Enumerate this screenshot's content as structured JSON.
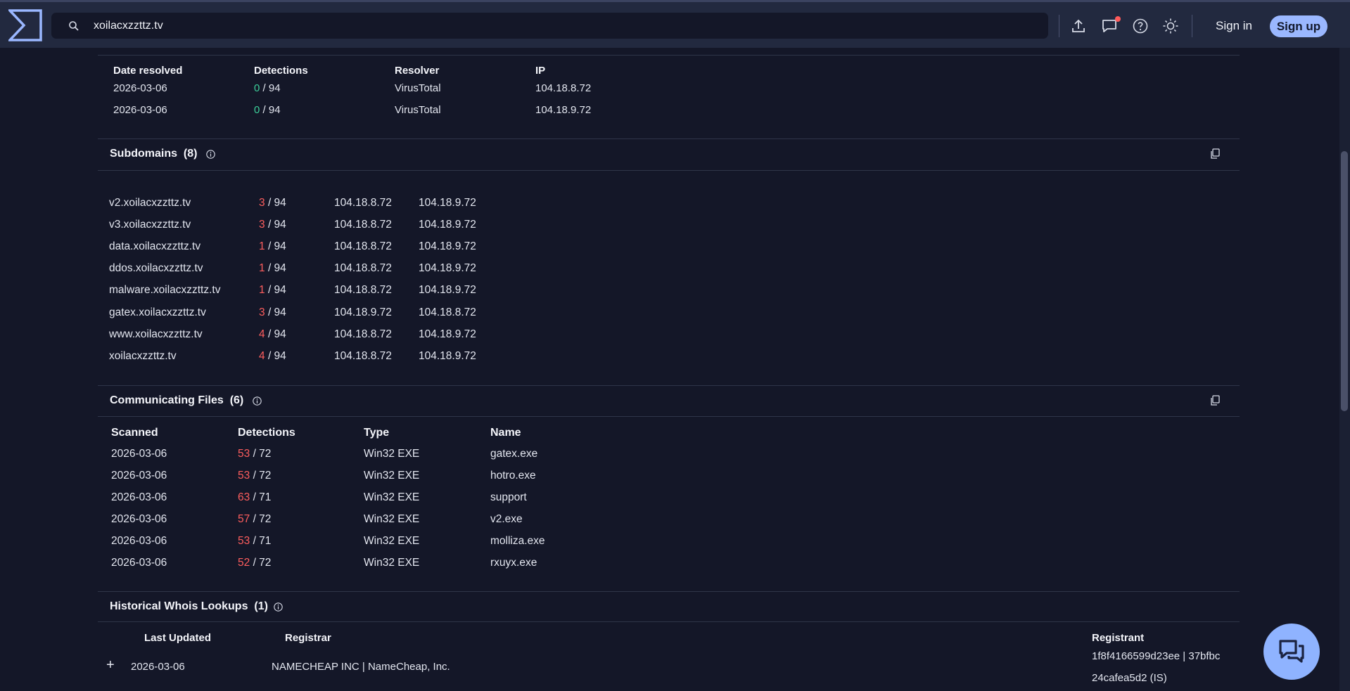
{
  "header": {
    "search_value": "xoilacxzzttz.tv",
    "signin_label": "Sign in",
    "signup_label": "Sign up"
  },
  "resolutions": {
    "columns": [
      "Date resolved",
      "Detections",
      "Resolver",
      "IP"
    ],
    "rows": [
      {
        "date": "2026-03-06",
        "det": "0",
        "total": "/ 94",
        "resolver": "VirusTotal",
        "ip": "104.18.8.72"
      },
      {
        "date": "2026-03-06",
        "det": "0",
        "total": "/ 94",
        "resolver": "VirusTotal",
        "ip": "104.18.9.72"
      }
    ]
  },
  "subdomains": {
    "title": "Subdomains",
    "count": "(8)",
    "rows": [
      {
        "name": "v2.xoilacxzzttz.tv",
        "det": "3",
        "total": "/ 94",
        "ip1": "104.18.8.72",
        "ip2": "104.18.9.72"
      },
      {
        "name": "v3.xoilacxzzttz.tv",
        "det": "3",
        "total": "/ 94",
        "ip1": "104.18.8.72",
        "ip2": "104.18.9.72"
      },
      {
        "name": "data.xoilacxzzttz.tv",
        "det": "1",
        "total": "/ 94",
        "ip1": "104.18.8.72",
        "ip2": "104.18.9.72"
      },
      {
        "name": "ddos.xoilacxzzttz.tv",
        "det": "1",
        "total": "/ 94",
        "ip1": "104.18.8.72",
        "ip2": "104.18.9.72"
      },
      {
        "name": "malware.xoilacxzzttz.tv",
        "det": "1",
        "total": "/ 94",
        "ip1": "104.18.8.72",
        "ip2": "104.18.9.72"
      },
      {
        "name": "gatex.xoilacxzzttz.tv",
        "det": "3",
        "total": "/ 94",
        "ip1": "104.18.9.72",
        "ip2": "104.18.8.72"
      },
      {
        "name": "www.xoilacxzzttz.tv",
        "det": "4",
        "total": "/ 94",
        "ip1": "104.18.8.72",
        "ip2": "104.18.9.72"
      },
      {
        "name": "xoilacxzzttz.tv",
        "det": "4",
        "total": "/ 94",
        "ip1": "104.18.8.72",
        "ip2": "104.18.9.72"
      }
    ]
  },
  "files": {
    "title": "Communicating Files",
    "count": "(6)",
    "columns": [
      "Scanned",
      "Detections",
      "Type",
      "Name"
    ],
    "rows": [
      {
        "date": "2026-03-06",
        "det": "53",
        "total": "/ 72",
        "type": "Win32 EXE",
        "name": "gatex.exe"
      },
      {
        "date": "2026-03-06",
        "det": "53",
        "total": "/ 72",
        "type": "Win32 EXE",
        "name": "hotro.exe"
      },
      {
        "date": "2026-03-06",
        "det": "63",
        "total": "/ 71",
        "type": "Win32 EXE",
        "name": "support"
      },
      {
        "date": "2026-03-06",
        "det": "57",
        "total": "/ 72",
        "type": "Win32 EXE",
        "name": "v2.exe"
      },
      {
        "date": "2026-03-06",
        "det": "53",
        "total": "/ 71",
        "type": "Win32 EXE",
        "name": "molliza.exe"
      },
      {
        "date": "2026-03-06",
        "det": "52",
        "total": "/ 72",
        "type": "Win32 EXE",
        "name": "rxuyx.exe"
      }
    ]
  },
  "whois": {
    "title": "Historical Whois Lookups",
    "count": "(1)",
    "col_updated": "Last Updated",
    "col_registrar": "Registrar",
    "col_registrant": "Registrant",
    "expand_symbol": "+",
    "row": {
      "date": "2026-03-06",
      "registrar": "NAMECHEAP INC | NameCheap, Inc.",
      "registrant_line1": "1f8f4166599d23ee | 37bfbc",
      "registrant_line2": "24cafea5d2 (IS)"
    }
  },
  "colors": {
    "background": "#141728",
    "topbar": "#22293f",
    "accent": "#9ab7ff",
    "detected": "#ff5e5e",
    "clean": "#3ccf9a"
  },
  "icons": [
    "logo-icon",
    "search-icon",
    "upload-icon",
    "chat-icon",
    "help-icon",
    "theme-icon",
    "info-icon",
    "copy-icon",
    "support-chat-icon"
  ]
}
